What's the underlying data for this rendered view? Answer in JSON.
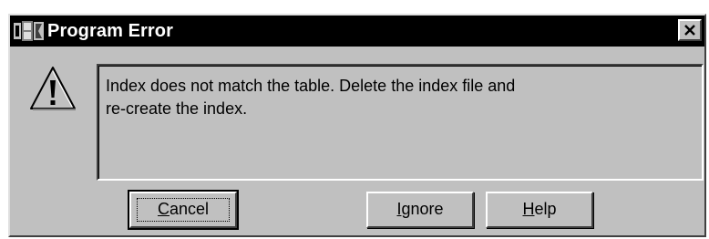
{
  "window": {
    "title": "Program Error",
    "app_icon": "foxpro-app-icon",
    "close_icon": "close-icon"
  },
  "dialog": {
    "icon": "warning-icon",
    "message": "Index does not match the table. Delete the index file and\nre-create the index."
  },
  "buttons": [
    {
      "label": "Cancel",
      "accelerator": "C",
      "default": true
    },
    {
      "label": "Ignore",
      "accelerator": "I",
      "default": false
    },
    {
      "label": "Help",
      "accelerator": "H",
      "default": false
    }
  ],
  "colors": {
    "titlebar": "#000000",
    "dialog_face": "#c0c0c0",
    "title_text": "#ffffff"
  }
}
